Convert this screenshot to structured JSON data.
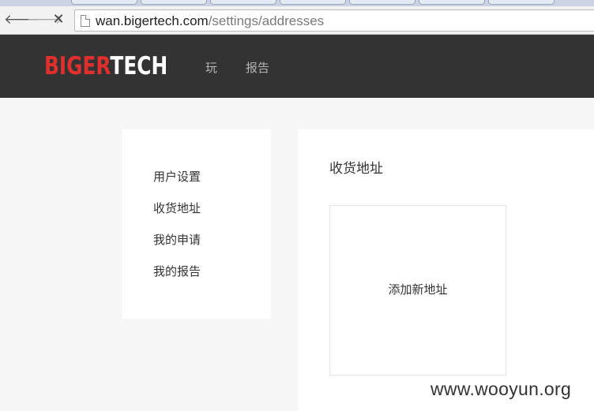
{
  "browser": {
    "back_glyph": "🡐",
    "forward_glyph": "🡒",
    "stop_glyph": "✕",
    "url_host": "wan.bigertech.com",
    "url_path": "/settings/addresses"
  },
  "header": {
    "logo_part1": "BIGER",
    "logo_part2": "TECH",
    "nav": [
      "玩",
      "报告"
    ]
  },
  "sidebar": {
    "items": [
      "用户设置",
      "收货地址",
      "我的申请",
      "我的报告"
    ]
  },
  "main": {
    "title": "收货地址",
    "add_address_label": "添加新地址"
  },
  "watermark": "www.wooyun.org",
  "colors": {
    "header_bg": "#333333",
    "logo_accent": "#e0302d",
    "page_bg": "#f7f7f7"
  }
}
